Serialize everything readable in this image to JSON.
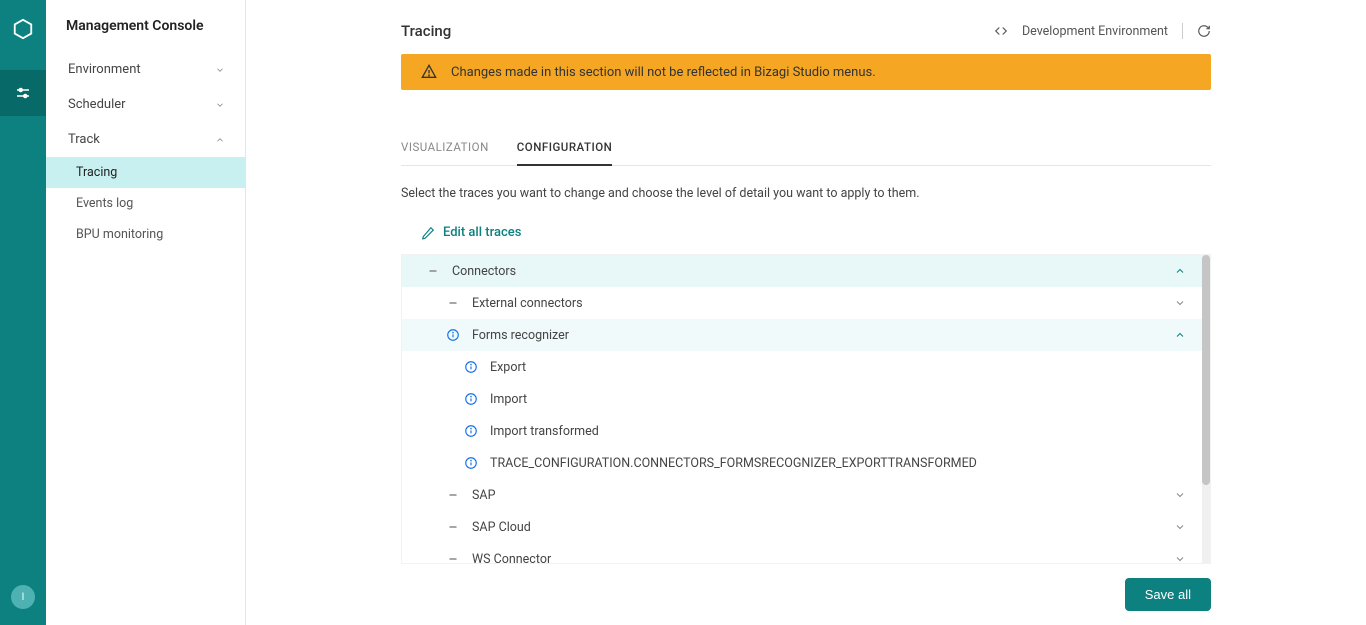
{
  "sidebar": {
    "title": "Management Console",
    "items": [
      {
        "label": "Environment",
        "expanded": false
      },
      {
        "label": "Scheduler",
        "expanded": false
      },
      {
        "label": "Track",
        "expanded": true
      }
    ],
    "subitems": [
      {
        "label": "Tracing",
        "active": true
      },
      {
        "label": "Events log",
        "active": false
      },
      {
        "label": "BPU monitoring",
        "active": false
      }
    ]
  },
  "rail": {
    "bottom_label": "I"
  },
  "header": {
    "title": "Tracing",
    "env": "Development Environment"
  },
  "banner": {
    "text": "Changes made in this section will not be reflected in Bizagi Studio menus."
  },
  "tabs": [
    {
      "label": "VISUALIZATION",
      "active": false
    },
    {
      "label": "CONFIGURATION",
      "active": true
    }
  ],
  "instruction": "Select the traces you want to change and choose the level of detail you want to apply to them.",
  "edit_all": "Edit all traces",
  "tree": [
    {
      "level": 0,
      "icon": "minus",
      "label": "Connectors",
      "chevron": "up",
      "teal_chevron": true,
      "bg": "light-teal"
    },
    {
      "level": 1,
      "icon": "minus",
      "label": "External connectors",
      "chevron": "down"
    },
    {
      "level": 1,
      "icon": "info",
      "label": "Forms recognizer",
      "chevron": "up",
      "teal_chevron": true,
      "bg": "light-teal"
    },
    {
      "level": 2,
      "icon": "info",
      "label": "Export"
    },
    {
      "level": 2,
      "icon": "info",
      "label": "Import"
    },
    {
      "level": 2,
      "icon": "info",
      "label": "Import transformed"
    },
    {
      "level": 2,
      "icon": "info",
      "label": "TRACE_CONFIGURATION.CONNECTORS_FORMSRECOGNIZER_EXPORTTRANSFORMED"
    },
    {
      "level": 1,
      "icon": "minus",
      "label": "SAP",
      "chevron": "down"
    },
    {
      "level": 1,
      "icon": "minus",
      "label": "SAP Cloud",
      "chevron": "down"
    },
    {
      "level": 1,
      "icon": "minus",
      "label": "WS Connector",
      "chevron": "down"
    }
  ],
  "footer": {
    "save": "Save all"
  }
}
